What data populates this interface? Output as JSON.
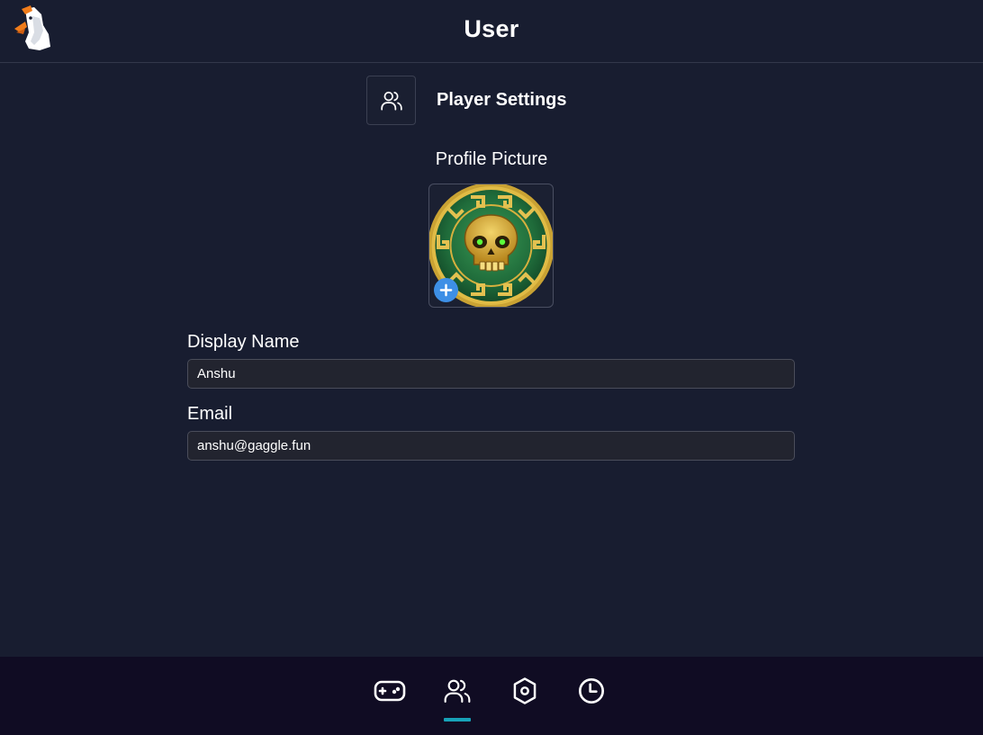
{
  "header": {
    "title": "User",
    "logo_icon": "goose-logo-icon"
  },
  "section": {
    "title": "Player Settings",
    "icon": "users-icon"
  },
  "profile": {
    "label": "Profile Picture",
    "avatar": "skull-medallion-avatar",
    "add_icon": "plus-icon"
  },
  "form": {
    "display_name_label": "Display Name",
    "display_name_value": "Anshu",
    "email_label": "Email",
    "email_value": "anshu@gaggle.fun"
  },
  "nav": {
    "items": [
      {
        "icon": "gamepad-icon"
      },
      {
        "icon": "users-icon",
        "active": true
      },
      {
        "icon": "settings-hex-icon"
      },
      {
        "icon": "clock-icon"
      }
    ],
    "indicator_color": "#17a2b8"
  },
  "colors": {
    "background": "#181d30",
    "nav_background": "#100c23",
    "accent": "#17a2b8",
    "add_button": "#3d8fe6"
  }
}
